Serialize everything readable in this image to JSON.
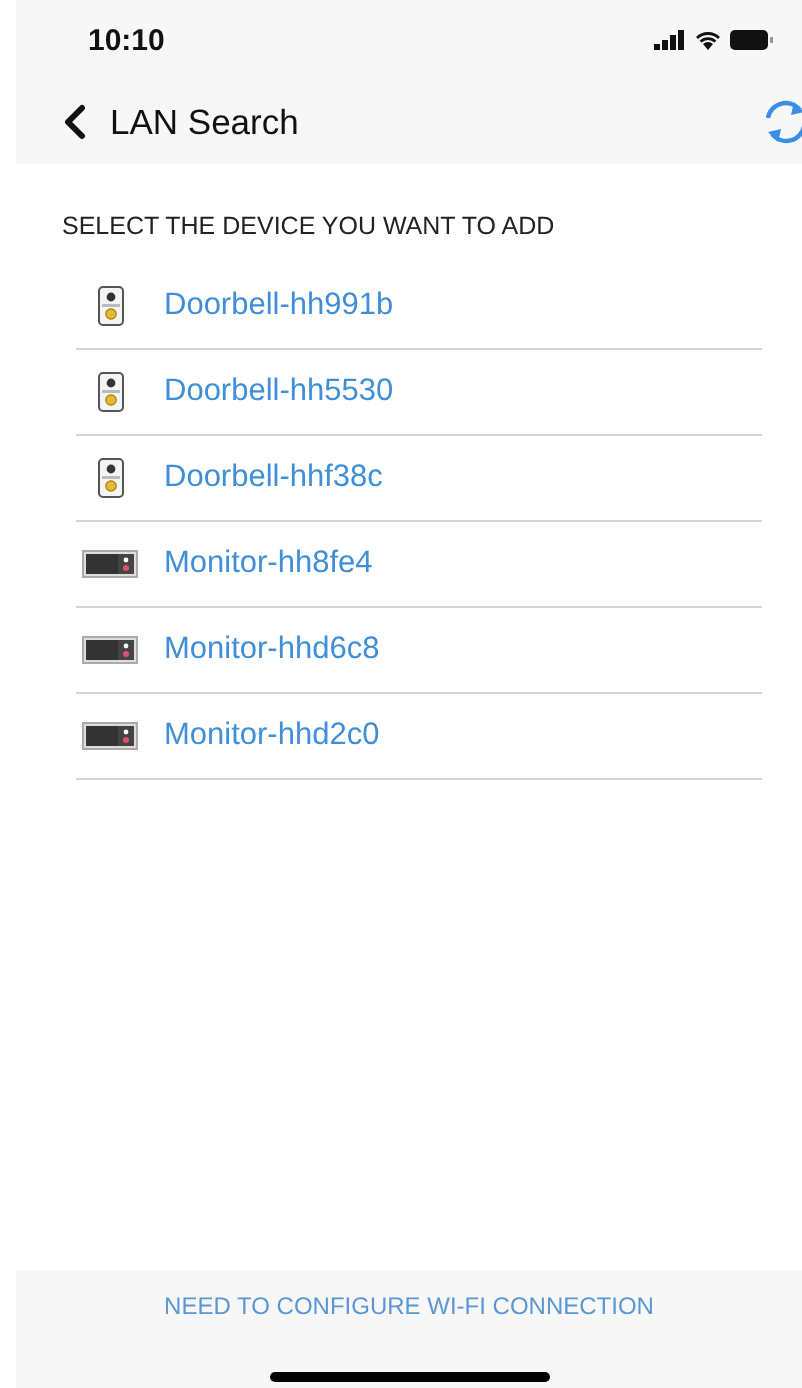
{
  "status_bar": {
    "time": "10:10"
  },
  "nav": {
    "title": "LAN Search"
  },
  "section_title": "SELECT THE DEVICE YOU WANT TO ADD",
  "devices": [
    {
      "kind": "doorbell",
      "name": "Doorbell-hh991b"
    },
    {
      "kind": "doorbell",
      "name": "Doorbell-hh5530"
    },
    {
      "kind": "doorbell",
      "name": "Doorbell-hhf38c"
    },
    {
      "kind": "monitor",
      "name": "Monitor-hh8fe4"
    },
    {
      "kind": "monitor",
      "name": "Monitor-hhd6c8"
    },
    {
      "kind": "monitor",
      "name": "Monitor-hhd2c0"
    }
  ],
  "footer_link": "NEED TO CONFIGURE WI-FI CONNECTION"
}
